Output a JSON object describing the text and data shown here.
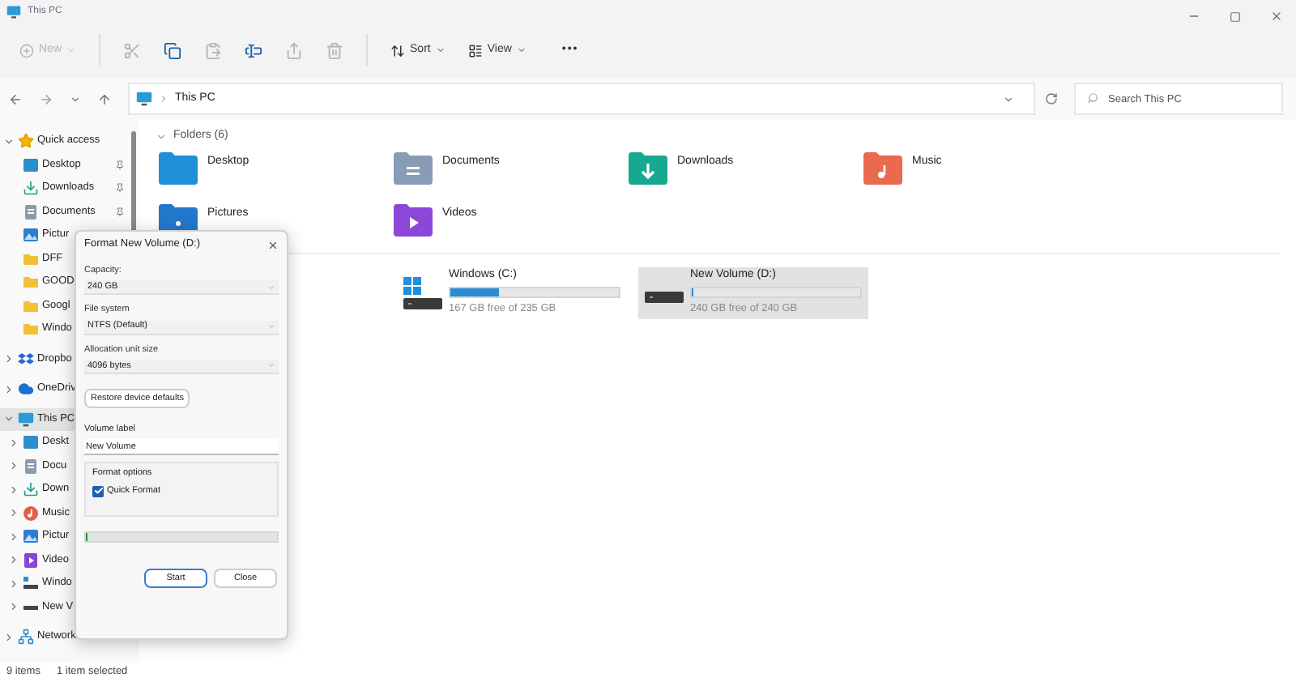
{
  "window": {
    "title": "This PC"
  },
  "toolbar": [
    {
      "kind": "new",
      "label": "New",
      "disabled": true
    },
    {
      "kind": "cut",
      "disabled": true
    },
    {
      "kind": "copy",
      "disabled": false
    },
    {
      "kind": "paste",
      "disabled": true
    },
    {
      "kind": "rename",
      "disabled": false
    },
    {
      "kind": "share",
      "disabled": true
    },
    {
      "kind": "delete",
      "disabled": true
    },
    {
      "kind": "sort",
      "label": "Sort",
      "disabled": false
    },
    {
      "kind": "view",
      "label": "View",
      "disabled": false
    },
    {
      "kind": "more",
      "label": "•••",
      "disabled": false
    }
  ],
  "address": {
    "path": "This PC",
    "search_placeholder": "Search This PC"
  },
  "sidebar": {
    "items": [
      {
        "kind": "star",
        "label": "Quick access",
        "expanded": true,
        "selected": false,
        "children": [
          {
            "kind": "desktop",
            "label": "Desktop",
            "pinned": true,
            "selected": false
          },
          {
            "kind": "downloads",
            "label": "Downloads",
            "pinned": true,
            "selected": false
          },
          {
            "kind": "documents",
            "label": "Documents",
            "pinned": true,
            "selected": false
          },
          {
            "kind": "pictures",
            "label": "Pictur",
            "selected": false
          },
          {
            "kind": "folder",
            "label": "DFF",
            "selected": false
          },
          {
            "kind": "folder",
            "label": "GOOD",
            "selected": false
          },
          {
            "kind": "folder",
            "label": "Googl",
            "selected": false
          },
          {
            "kind": "folder",
            "label": "Windo",
            "selected": false
          }
        ]
      },
      {
        "kind": "dropbox",
        "label": "Dropbo",
        "expanded": false,
        "selected": false
      },
      {
        "kind": "cloud",
        "label": "OneDriv",
        "expanded": false,
        "selected": false
      },
      {
        "kind": "pc",
        "label": "This PC",
        "expanded": true,
        "selected": true,
        "children": [
          {
            "kind": "desktop",
            "label": "Deskt",
            "expanded": false,
            "selected": false
          },
          {
            "kind": "documents",
            "label": "Docu",
            "expanded": false,
            "selected": false
          },
          {
            "kind": "downloads",
            "label": "Down",
            "expanded": false,
            "selected": false
          },
          {
            "kind": "music",
            "label": "Music",
            "expanded": false,
            "selected": false
          },
          {
            "kind": "pictures",
            "label": "Pictur",
            "expanded": false,
            "selected": false
          },
          {
            "kind": "videos",
            "label": "Video",
            "expanded": false,
            "selected": false
          },
          {
            "kind": "windrive",
            "label": "Windo",
            "expanded": false,
            "selected": false
          },
          {
            "kind": "drive",
            "label": "New V",
            "expanded": false,
            "selected": false
          }
        ]
      },
      {
        "kind": "network",
        "label": "Network",
        "expanded": false,
        "selected": false
      }
    ]
  },
  "folders": {
    "heading": "Folders (6)",
    "expanded": true,
    "items": [
      {
        "kind": "desktop",
        "label": "Desktop"
      },
      {
        "kind": "documents",
        "label": "Documents"
      },
      {
        "kind": "downloads",
        "label": "Downloads"
      },
      {
        "kind": "music",
        "label": "Music"
      },
      {
        "kind": "pictures",
        "label": "Pictures"
      },
      {
        "kind": "videos",
        "label": "Videos"
      }
    ]
  },
  "drives": [
    {
      "kind": "windrive",
      "label": "Windows (C:)",
      "level": 0.29,
      "free": "167 GB free of 235 GB",
      "selected": false
    },
    {
      "kind": "drive",
      "label": "New Volume (D:)",
      "level": 0,
      "free": "240 GB free of 240 GB",
      "selected": true
    }
  ],
  "dialog": {
    "title": "Format New Volume (D:)",
    "selects": [
      {
        "label": "Capacity:",
        "value": "240 GB"
      },
      {
        "label": "File system",
        "value": "NTFS (Default)"
      },
      {
        "label": "Allocation unit size",
        "value": "4096 bytes"
      }
    ],
    "restore_button": "Restore device defaults",
    "volume_label": {
      "label": "Volume label",
      "value": "New Volume"
    },
    "format_options": {
      "heading": "Format options",
      "options": [
        {
          "label": "Quick Format",
          "checked": true
        }
      ]
    },
    "progress": {
      "level": 0
    },
    "buttons": [
      {
        "label": "Start",
        "default": true
      },
      {
        "label": "Close",
        "default": false
      }
    ]
  },
  "status_bar": {
    "count": "9 items",
    "selection": "1 item selected"
  }
}
